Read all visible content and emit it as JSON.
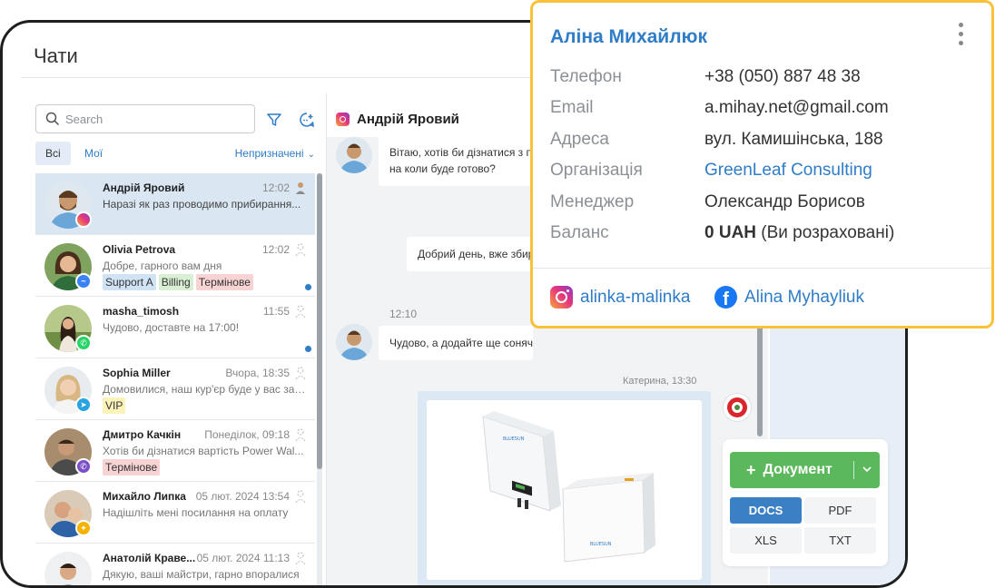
{
  "page": {
    "title": "Чати"
  },
  "search": {
    "placeholder": "Search"
  },
  "filters": {
    "all": "Всі",
    "mine": "Мої",
    "unassigned": "Непризначені"
  },
  "chats": [
    {
      "name": "Андрій Яровий",
      "time": "12:02",
      "preview": "Наразі як раз проводимо прибирання...",
      "channel": "instagram",
      "tags": [],
      "unread": false,
      "active": true
    },
    {
      "name": "Olivia Petrova",
      "time": "12:02",
      "preview": "Добре, гарного вам дня",
      "channel": "messenger",
      "tags": [
        {
          "label": "Support A",
          "color": "blue"
        },
        {
          "label": "Billing",
          "color": "green"
        },
        {
          "label": "Термінове",
          "color": "red"
        }
      ],
      "unread": true,
      "active": false
    },
    {
      "name": "masha_timosh",
      "time": "11:55",
      "preview": "Чудово, доставте на 17:00!",
      "channel": "whatsapp",
      "tags": [],
      "unread": true,
      "active": false
    },
    {
      "name": "Sophia Miller",
      "time": "Вчора, 18:35",
      "preview": "Домовилися, наш кур'єр буде у вас завт...",
      "channel": "telegram",
      "tags": [
        {
          "label": "VIP",
          "color": "yellow"
        }
      ],
      "unread": false,
      "active": false
    },
    {
      "name": "Дмитро Качкін",
      "time": "Понеділок, 09:18",
      "preview": "Хотів би дізнатися вартість Power Wal...",
      "channel": "viber",
      "tags": [
        {
          "label": "Термінове",
          "color": "red"
        }
      ],
      "unread": false,
      "active": false
    },
    {
      "name": "Михайло Липка",
      "time": "05 лют. 2024 13:54",
      "preview": "Надішліть мені посилання на оплату",
      "channel": "other",
      "tags": [],
      "unread": false,
      "active": false
    },
    {
      "name": "Анатолій Краве...",
      "time": "05 лют. 2024 11:13",
      "preview": "Дякую, ваші майстри, гарно впоралися",
      "channel": "other",
      "tags": [],
      "unread": false,
      "active": false
    }
  ],
  "conversation": {
    "contact_name": "Андрій Яровий",
    "messages": [
      {
        "text_line1": "Вітаю, хотів би дізнатися з п",
        "text_line2": "на коли буде готово?"
      },
      {
        "text_line1": "Добрий день, вже збир"
      },
      {
        "time": "12:10",
        "text_line1": "Чудово, а додайте ще соняч"
      },
      {
        "caption": "Катерина, 13:30"
      }
    ],
    "product_brand": "BLUESUN"
  },
  "document_widget": {
    "button_label": "Документ",
    "formats": [
      "DOCS",
      "PDF",
      "XLS",
      "TXT"
    ],
    "selected": "DOCS"
  },
  "contact_card": {
    "name": "Аліна Михайлюк",
    "fields": [
      {
        "label": "Телефон",
        "value": "+38 (050) 887 48 38"
      },
      {
        "label": "Email",
        "value": "a.mihay.net@gmail.com"
      },
      {
        "label": "Адреса",
        "value": "вул. Камишінська, 188"
      },
      {
        "label": "Організація",
        "value": "GreenLeaf Consulting"
      },
      {
        "label": "Менеджер",
        "value": "Олександр Борисов"
      },
      {
        "label": "Баланс",
        "value_bold": "0 UAH",
        "value_rest": " (Ви розраховані)"
      }
    ],
    "instagram": "alinka-malinka",
    "facebook": "Alina Myhayliuk"
  },
  "colors": {
    "accent": "#2f7cc7",
    "card_border": "#f7c235",
    "doc_button": "#5cb85c",
    "selected_format": "#3b7fc4"
  }
}
